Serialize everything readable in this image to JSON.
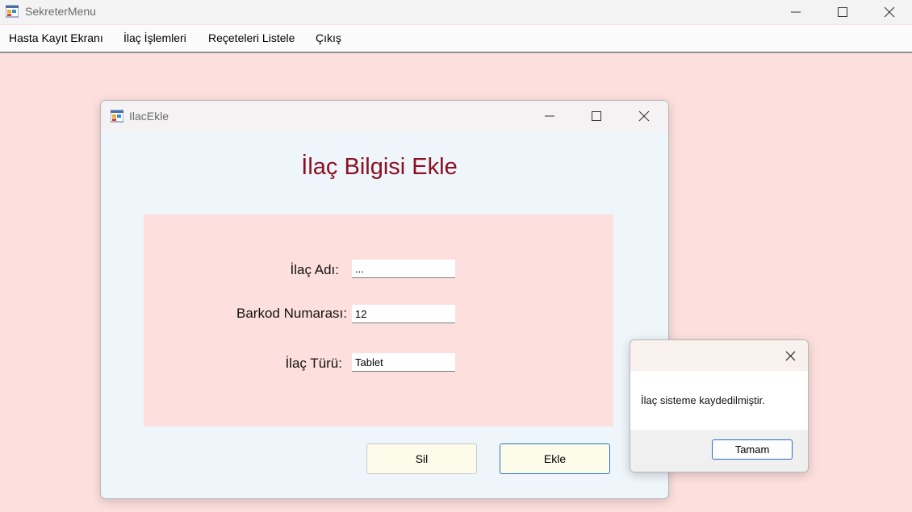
{
  "main_window": {
    "title": "SekreterMenu",
    "icon": "winforms-app-icon",
    "controls": [
      "minimize-icon",
      "maximize-icon",
      "close-icon"
    ]
  },
  "menu": {
    "items": [
      {
        "label": "Hasta Kayıt Ekranı"
      },
      {
        "label": "İlaç İşlemleri"
      },
      {
        "label": "Reçeteleri Listele"
      },
      {
        "label": "Çıkış"
      }
    ]
  },
  "child_window": {
    "title": "IlacEkle",
    "heading": "İlaç Bilgisi Ekle",
    "fields": [
      {
        "label": "İlaç Adı:",
        "value": "..."
      },
      {
        "label": "Barkod Numarası:",
        "value": "12"
      },
      {
        "label": "İlaç Türü:",
        "value": "Tablet"
      }
    ],
    "buttons": {
      "delete": "Sil",
      "add": "Ekle"
    }
  },
  "message_box": {
    "text": "İlaç sisteme kaydedilmiştir.",
    "ok_button": "Tamam"
  },
  "colors": {
    "background": "#fde0de",
    "heading": "#8b1020",
    "child_background": "#eef5fb",
    "button_fill": "#fdfbea",
    "focus_border": "#2a6fc8"
  }
}
